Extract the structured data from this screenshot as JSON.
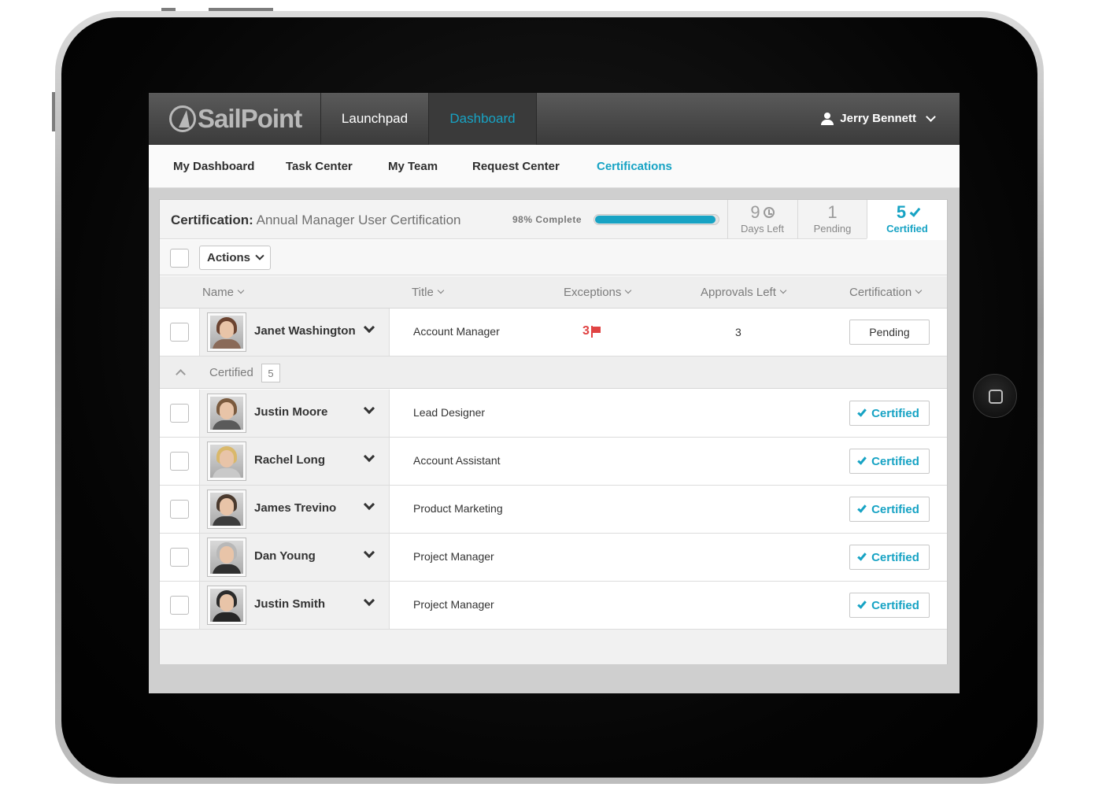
{
  "app": {
    "logo_text": "SailPoint",
    "top_nav": [
      "Launchpad",
      "Dashboard"
    ],
    "active_top_nav": "Dashboard",
    "user_name": "Jerry Bennett"
  },
  "sub_nav": {
    "items": [
      "My Dashboard",
      "Task Center",
      "My Team",
      "Request Center",
      "Certifications"
    ],
    "active": "Certifications"
  },
  "certification": {
    "label": "Certification:",
    "name": "Annual Manager User Certification",
    "percent_text": "98% Complete",
    "percent_value": 98,
    "stats": {
      "days_left": {
        "value": "9",
        "label": "Days Left"
      },
      "pending": {
        "value": "1",
        "label": "Pending"
      },
      "certified": {
        "value": "5",
        "label": "Certified"
      }
    }
  },
  "toolbar": {
    "actions_label": "Actions"
  },
  "columns": [
    "Name",
    "Title",
    "Exceptions",
    "Approvals Left",
    "Certification"
  ],
  "pending_rows": [
    {
      "name": "Janet Washington",
      "title": "Account Manager",
      "exceptions": "3",
      "approvals_left": "3",
      "status": "Pending"
    }
  ],
  "certified_group": {
    "label": "Certified",
    "count": "5"
  },
  "certified_rows": [
    {
      "name": "Justin Moore",
      "title": "Lead Designer",
      "status": "Certified"
    },
    {
      "name": "Rachel Long",
      "title": "Account Assistant",
      "status": "Certified"
    },
    {
      "name": "James Trevino",
      "title": "Product Marketing",
      "status": "Certified"
    },
    {
      "name": "Dan Young",
      "title": "Project Manager",
      "status": "Certified"
    },
    {
      "name": "Justin Smith",
      "title": "Project Manager",
      "status": "Certified"
    }
  ],
  "colors": {
    "accent": "#17a3c4",
    "exception_red": "#e04343",
    "appbar_dark": "#3b3b3b"
  },
  "icons": [
    "user-icon",
    "chevron-down-icon",
    "alarm-clock-icon",
    "checkmark-icon",
    "flag-icon",
    "chevron-up-icon",
    "home-button-icon"
  ]
}
